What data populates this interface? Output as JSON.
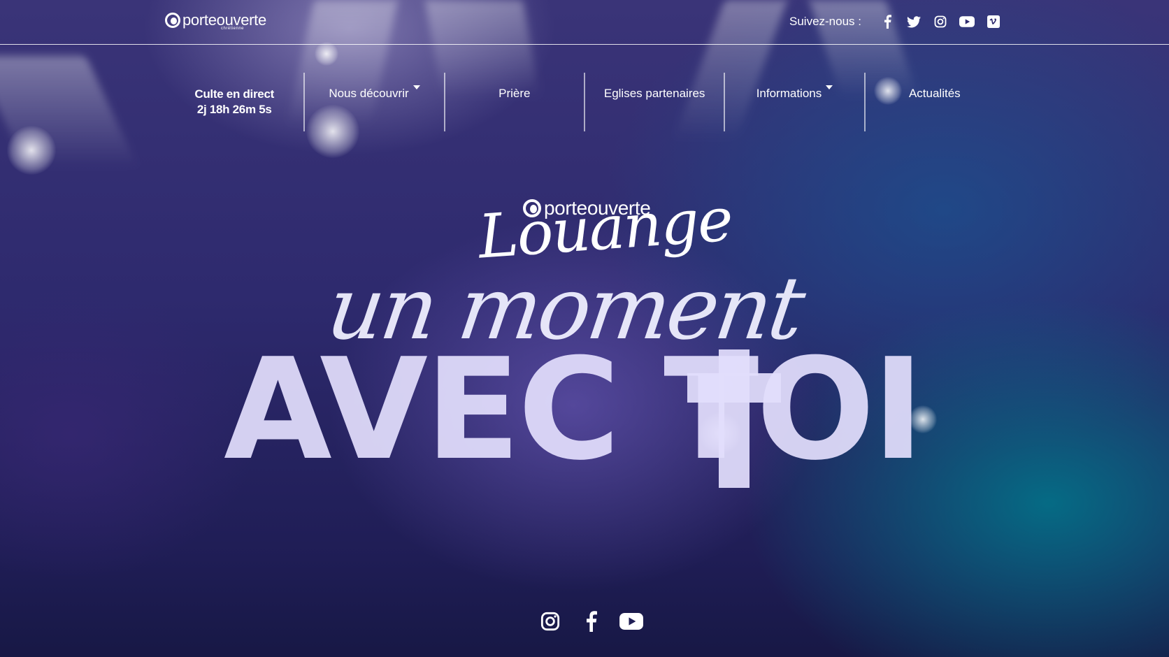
{
  "header": {
    "logo_text": "porteouverte",
    "logo_sub": "chrétienne",
    "follow_label": "Suivez-nous :",
    "social": [
      {
        "name": "facebook-icon"
      },
      {
        "name": "twitter-icon"
      },
      {
        "name": "instagram-icon"
      },
      {
        "name": "youtube-icon"
      },
      {
        "name": "vimeo-icon"
      }
    ]
  },
  "nav": {
    "live_label": "Culte en direct",
    "live_countdown": "2j 18h 26m 5s",
    "items": [
      {
        "label": "Nous découvrir",
        "has_dropdown": true
      },
      {
        "label": "Prière",
        "has_dropdown": false
      },
      {
        "label": "Eglises partenaires",
        "has_dropdown": false
      },
      {
        "label": "Informations",
        "has_dropdown": true
      },
      {
        "label": "Actualités",
        "has_dropdown": false
      }
    ]
  },
  "hero": {
    "brand": "porteouverte",
    "script_title": "Louange",
    "line1": "un moment",
    "line2": "AVEC TOI"
  },
  "footer_social": [
    {
      "name": "instagram-icon"
    },
    {
      "name": "facebook-icon"
    },
    {
      "name": "youtube-icon"
    }
  ]
}
